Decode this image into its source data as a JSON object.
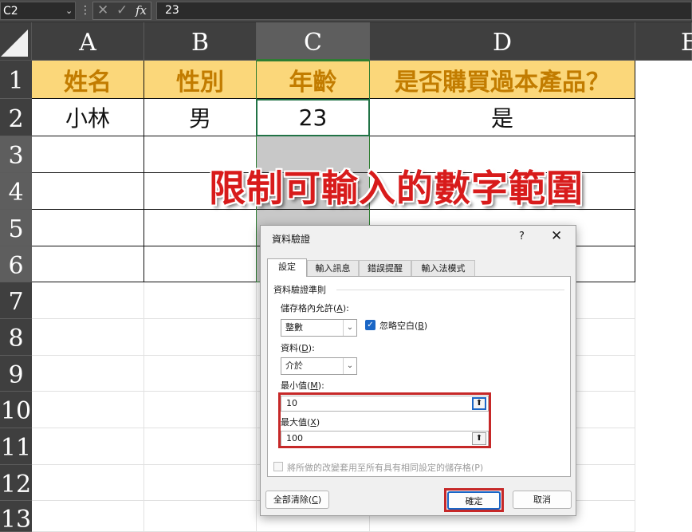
{
  "formula_bar": {
    "name_box": "C2",
    "name_box_arrow": "⌄",
    "dots": "⋮",
    "cancel_icon": "✕",
    "enter_icon": "✓",
    "fx_label": "fx",
    "formula": "23"
  },
  "sheet": {
    "columns": [
      "A",
      "B",
      "C",
      "D",
      "E"
    ],
    "rows": [
      "1",
      "2",
      "3",
      "4",
      "5",
      "6",
      "7",
      "8",
      "9",
      "10",
      "11",
      "12",
      "13"
    ],
    "headers": {
      "a1": "姓名",
      "b1": "性別",
      "c1": "年齡",
      "d1": "是否購買過本產品？"
    },
    "row2": {
      "a2": "小林",
      "b2": "男",
      "c2": "23",
      "d2": "是"
    },
    "selected_column": "C",
    "header_fill": "#fbd77a",
    "header_text_color": "#c27c00"
  },
  "annotation": {
    "text": "限制可輸入的數字範圍",
    "color": "#d81b1b"
  },
  "dialog": {
    "title": "資料驗證",
    "help": "?",
    "close": "✕",
    "tabs": [
      "設定",
      "輸入訊息",
      "錯誤提醒",
      "輸入法模式"
    ],
    "group_label": "資料驗證準則",
    "allow": {
      "label": "儲存格內允許(",
      "key": "A",
      "suffix": "):",
      "value": "整數",
      "arrow": "⌄"
    },
    "ignore_blank": {
      "label": "忽略空白(",
      "key": "B",
      "suffix": ")",
      "checked": true,
      "mark": "✓"
    },
    "data": {
      "label": "資料(",
      "key": "D",
      "suffix": "):",
      "value": "介於",
      "arrow": "⌄"
    },
    "minimum": {
      "label": "最小值(",
      "key": "M",
      "suffix": "):",
      "value": "10",
      "ref_icon": "⬆"
    },
    "maximum": {
      "label": "最大值(",
      "key": "X",
      "suffix": ")",
      "value": "100",
      "ref_icon": "⬆"
    },
    "apply_all": "將所做的改變套用至所有具有相同設定的儲存格(P)",
    "clear_all": {
      "label": "全部清除(",
      "key": "C",
      "suffix": ")"
    },
    "ok": "確定",
    "cancel": "取消",
    "highlight_color": "#c62828"
  }
}
